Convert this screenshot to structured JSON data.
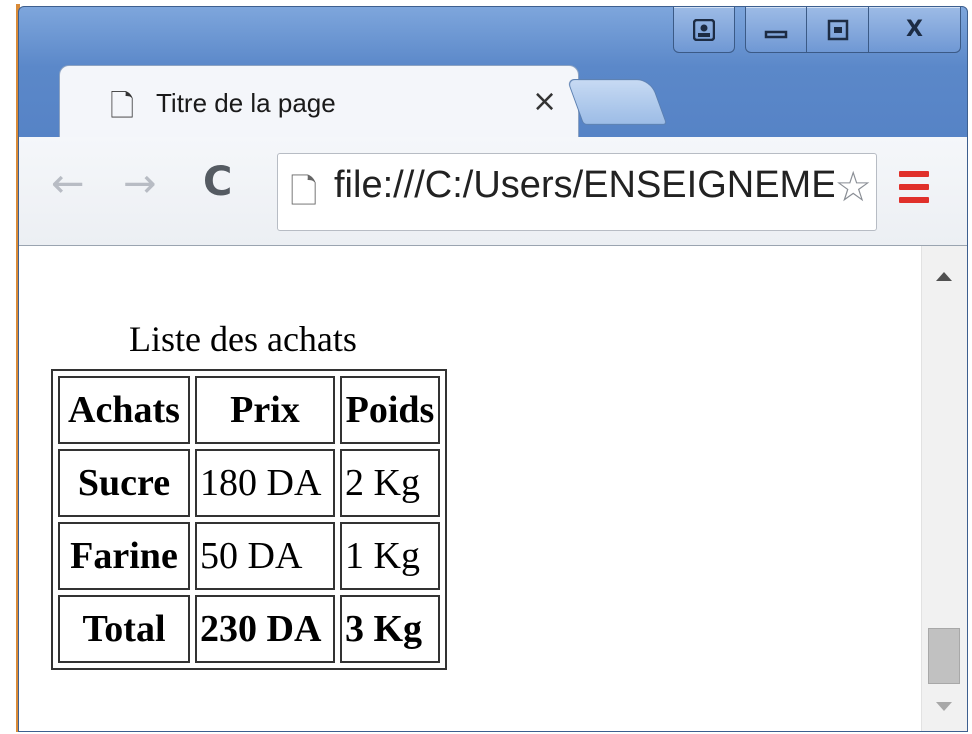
{
  "window": {
    "caption_buttons": {
      "user_icon": "user-icon",
      "minimize_icon": "minimize-icon",
      "maximize_icon": "maximize-icon",
      "close_label": "X"
    }
  },
  "tab": {
    "icon": "page-icon",
    "title": "Titre de la page",
    "close": "×"
  },
  "toolbar": {
    "back": "←",
    "forward": "→",
    "reload": "C",
    "address": "file:///C:/Users/ENSEIGNEMENT",
    "star": "☆",
    "menu_icon": "hamburger-menu-icon",
    "menu_color": "#e0302a"
  },
  "page": {
    "caption": "Liste des achats",
    "table": {
      "headers": [
        "Achats",
        "Prix",
        "Poids"
      ],
      "rows": [
        [
          "Sucre",
          "180 DA",
          "2 Kg"
        ],
        [
          "Farine",
          "50 DA",
          "1 Kg"
        ],
        [
          "Total",
          "230 DA",
          "3 Kg"
        ]
      ]
    }
  }
}
